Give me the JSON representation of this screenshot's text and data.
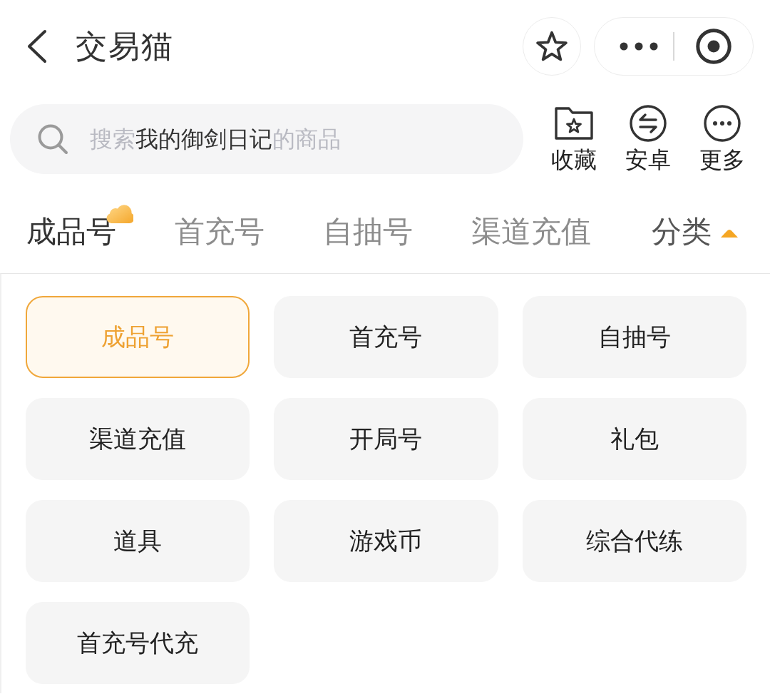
{
  "header": {
    "title": "交易猫"
  },
  "search": {
    "placeholder": {
      "prefix": "搜索",
      "keyword": "我的御剑日记",
      "suffix": "的商品"
    }
  },
  "shortcuts": [
    {
      "kind": "favorite",
      "label": "收藏"
    },
    {
      "kind": "android",
      "label": "安卓"
    },
    {
      "kind": "more",
      "label": "更多"
    }
  ],
  "tabs": [
    {
      "label": "成品号",
      "selected": true,
      "badge": true
    },
    {
      "label": "首充号",
      "selected": false,
      "badge": false
    },
    {
      "label": "自抽号",
      "selected": false,
      "badge": false
    },
    {
      "label": "渠道充值",
      "selected": false,
      "badge": false
    }
  ],
  "category_toggle": {
    "label": "分类",
    "expanded": true
  },
  "categories": [
    {
      "label": "成品号",
      "selected": true
    },
    {
      "label": "首充号",
      "selected": false
    },
    {
      "label": "自抽号",
      "selected": false
    },
    {
      "label": "渠道充值",
      "selected": false
    },
    {
      "label": "开局号",
      "selected": false
    },
    {
      "label": "礼包",
      "selected": false
    },
    {
      "label": "道具",
      "selected": false
    },
    {
      "label": "游戏币",
      "selected": false
    },
    {
      "label": "综合代练",
      "selected": false
    },
    {
      "label": "首充号代充",
      "selected": false
    }
  ]
}
